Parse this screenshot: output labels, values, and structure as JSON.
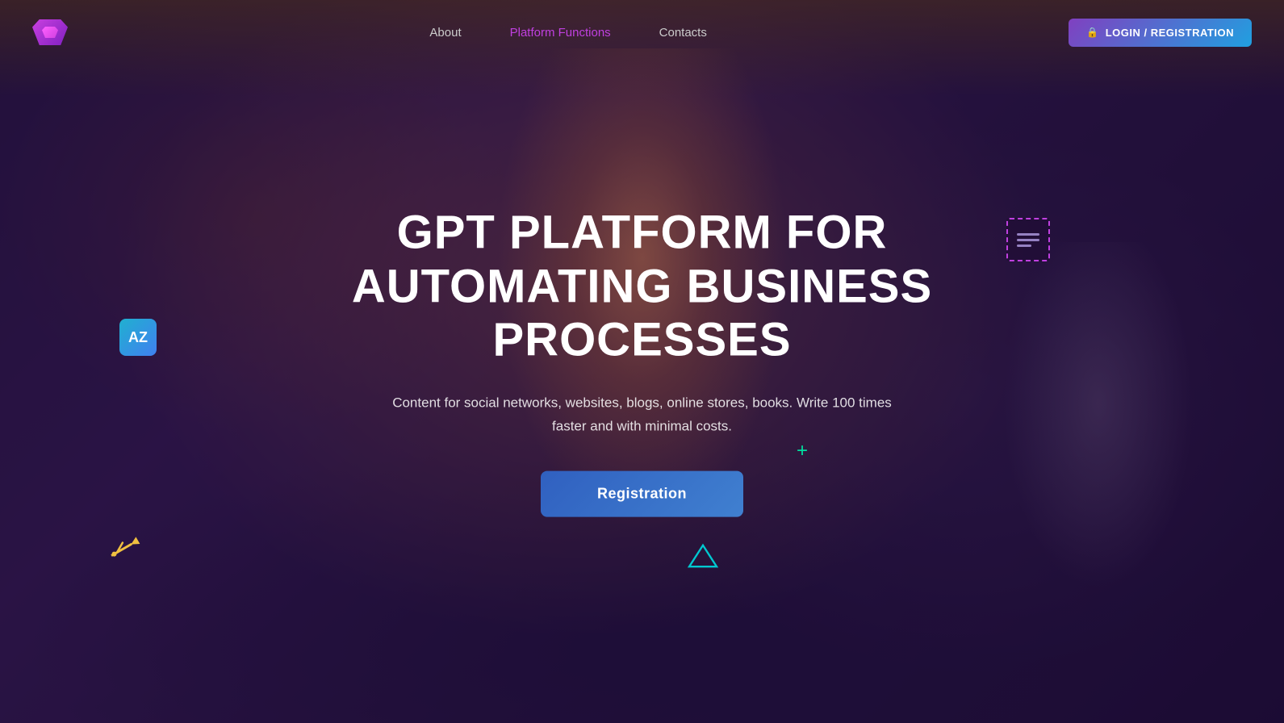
{
  "nav": {
    "logo_alt": "Logo",
    "links": [
      {
        "label": "About",
        "active": false
      },
      {
        "label": "Platform Functions",
        "active": true
      },
      {
        "label": "Contacts",
        "active": false
      }
    ],
    "login_button": "LOGIN / REGISTRATION"
  },
  "hero": {
    "title_line1": "GPT PLATFORM FOR",
    "title_line2": "AUTOMATING BUSINESS PROCESSES",
    "subtitle": "Content for social networks, websites, blogs, online stores, books. Write 100 times faster and with minimal costs.",
    "cta_button": "Registration"
  },
  "decorations": {
    "az_icon": "AZ",
    "pencil_icon": "✏",
    "plus_icon": "+",
    "lock_icon": "🔒"
  },
  "colors": {
    "accent_purple": "#c040e0",
    "accent_cyan": "#00e0a0",
    "gradient_start": "#8040c0",
    "gradient_end": "#20a0e0"
  }
}
